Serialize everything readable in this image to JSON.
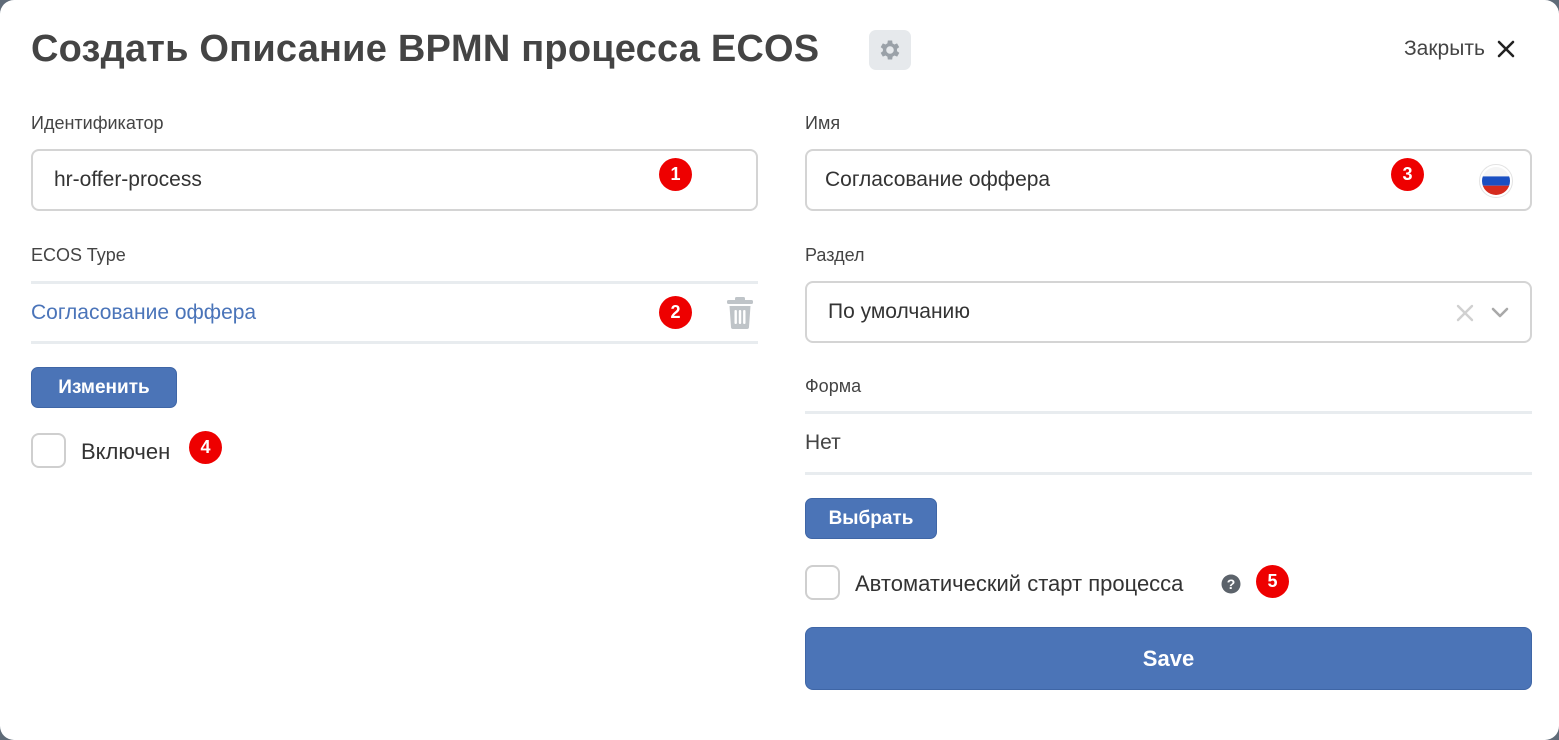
{
  "header": {
    "title": "Создать Описание BPMN процесса ECOS",
    "close_label": "Закрыть",
    "settings_icon": "gear-icon",
    "close_icon": "close-icon"
  },
  "left": {
    "identifier": {
      "label": "Идентификатор",
      "value": "hr-offer-process"
    },
    "ecos_type": {
      "label": "ECOS Type",
      "value": "Согласование оффера",
      "delete_icon": "trash-icon"
    },
    "change_button": "Изменить",
    "enabled_checkbox": {
      "label": "Включен",
      "checked": false
    }
  },
  "right": {
    "name": {
      "label": "Имя",
      "value": "Согласование оффера",
      "locale_icon": "russian-flag-icon"
    },
    "section": {
      "label": "Раздел",
      "value": "По умолчанию"
    },
    "form": {
      "label": "Форма",
      "value": "Нет"
    },
    "select_button": "Выбрать",
    "autostart_checkbox": {
      "label": "Автоматический старт процесса",
      "checked": false,
      "help_icon": "question-icon"
    },
    "save_button": "Save"
  },
  "badges": [
    "1",
    "2",
    "3",
    "4",
    "5"
  ],
  "colors": {
    "accent": "#4b74b7",
    "link": "#4a74b9",
    "badge": "#ee0000",
    "text": "#444444"
  }
}
